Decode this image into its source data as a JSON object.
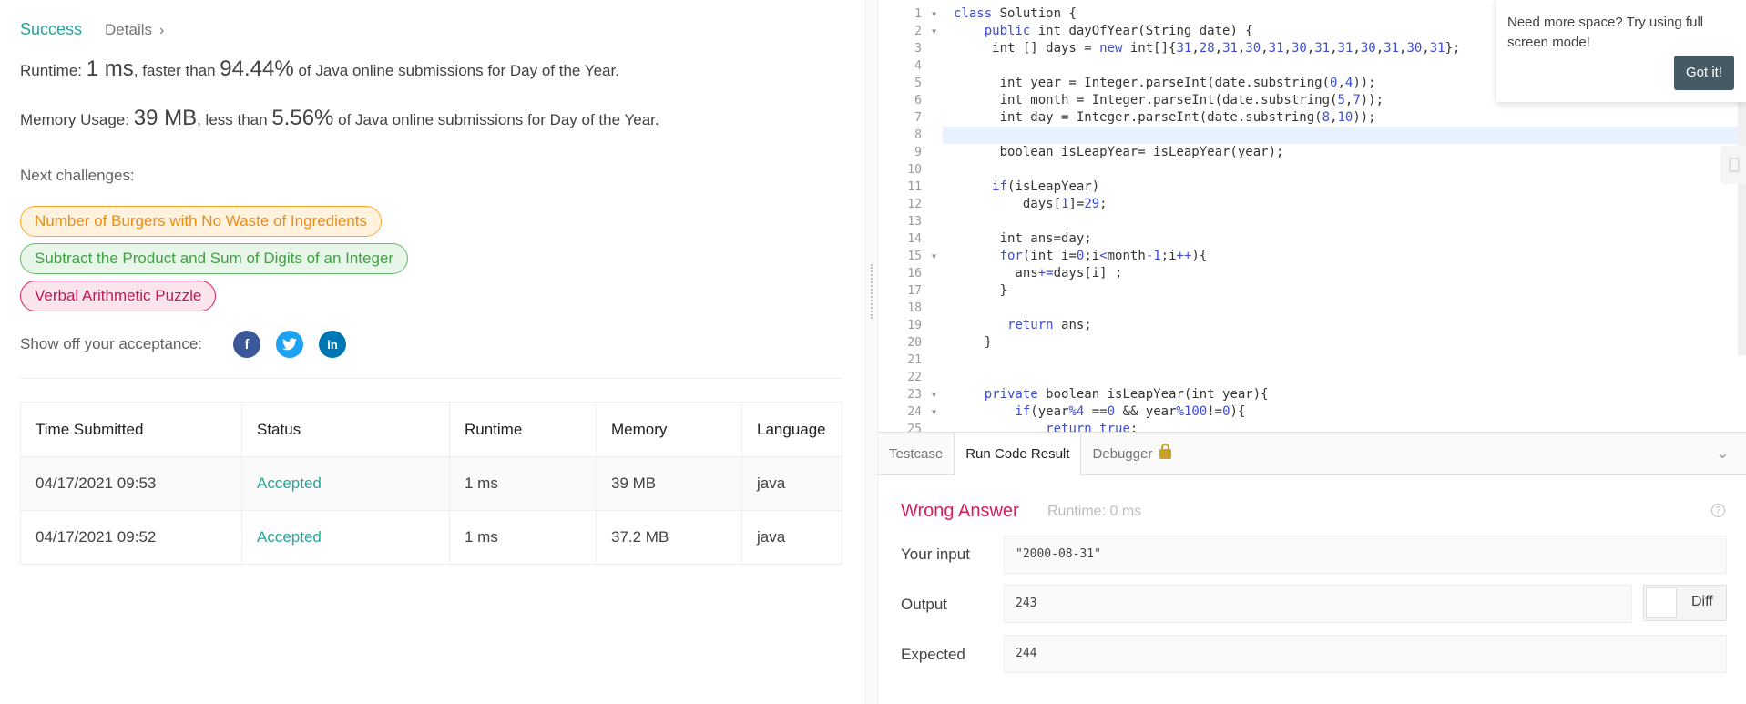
{
  "result": {
    "status": "Success",
    "details_label": "Details",
    "runtime_label": "Runtime:",
    "runtime_value": "1 ms",
    "runtime_mid": ", faster than",
    "runtime_pct": "94.44%",
    "runtime_tail": "of Java online submissions for Day of the Year.",
    "memory_label": "Memory Usage:",
    "memory_value": "39 MB",
    "memory_mid": ", less than",
    "memory_pct": "5.56%",
    "memory_tail": "of Java online submissions for Day of the Year.",
    "next_label": "Next challenges:",
    "challenges": [
      "Number of Burgers with No Waste of Ingredients",
      "Subtract the Product and Sum of Digits of an Integer",
      "Verbal Arithmetic Puzzle"
    ],
    "share_label": "Show off your acceptance:"
  },
  "submissions": {
    "headers": [
      "Time Submitted",
      "Status",
      "Runtime",
      "Memory",
      "Language"
    ],
    "rows": [
      {
        "time": "04/17/2021 09:53",
        "status": "Accepted",
        "runtime": "1 ms",
        "memory": "39 MB",
        "language": "java"
      },
      {
        "time": "04/17/2021 09:52",
        "status": "Accepted",
        "runtime": "1 ms",
        "memory": "37.2 MB",
        "language": "java"
      }
    ]
  },
  "tooltip": {
    "text": "Need more space? Try using full screen mode!",
    "button": "Got it!"
  },
  "console": {
    "tabs": [
      "Testcase",
      "Run Code Result",
      "Debugger"
    ],
    "verdict": "Wrong Answer",
    "runtime": "Runtime: 0 ms",
    "input_label": "Your input",
    "input_value": "\"2000-08-31\"",
    "output_label": "Output",
    "output_value": "243",
    "expected_label": "Expected",
    "expected_value": "244",
    "diff_label": "Diff"
  },
  "colors": {
    "success": "#26a69a",
    "wrong": "#d81b60",
    "keyword": "#3c4dd3"
  }
}
